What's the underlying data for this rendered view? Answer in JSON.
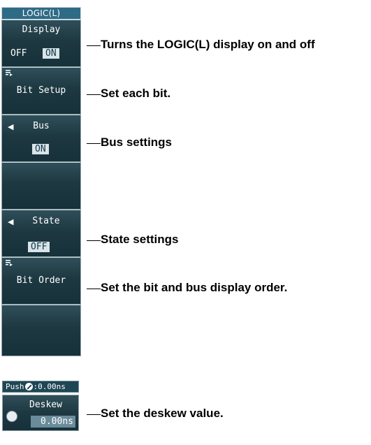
{
  "menu": {
    "header": "LOGIC(L)",
    "display": {
      "label": "Display",
      "off": "OFF",
      "on": "ON"
    },
    "bit_setup": {
      "label": "Bit Setup"
    },
    "bus": {
      "label": "Bus",
      "value": "ON"
    },
    "state": {
      "label": "State",
      "value": "OFF"
    },
    "bit_order": {
      "label": "Bit Order"
    }
  },
  "callouts": {
    "display": "Turns the LOGIC(L) display on and off",
    "bit_setup": "Set each bit.",
    "bus": "Bus settings",
    "state": "State settings",
    "bit_order": "Set the bit and bus display order.",
    "deskew": "Set the deskew value."
  },
  "deskew": {
    "push_prefix": "Push",
    "push_suffix": ":0.00ns",
    "label": "Deskew",
    "value": "0.00ns"
  },
  "colors": {
    "panel": "#1d3841",
    "header": "#2e6b86",
    "chip": "#d9e4e8"
  }
}
